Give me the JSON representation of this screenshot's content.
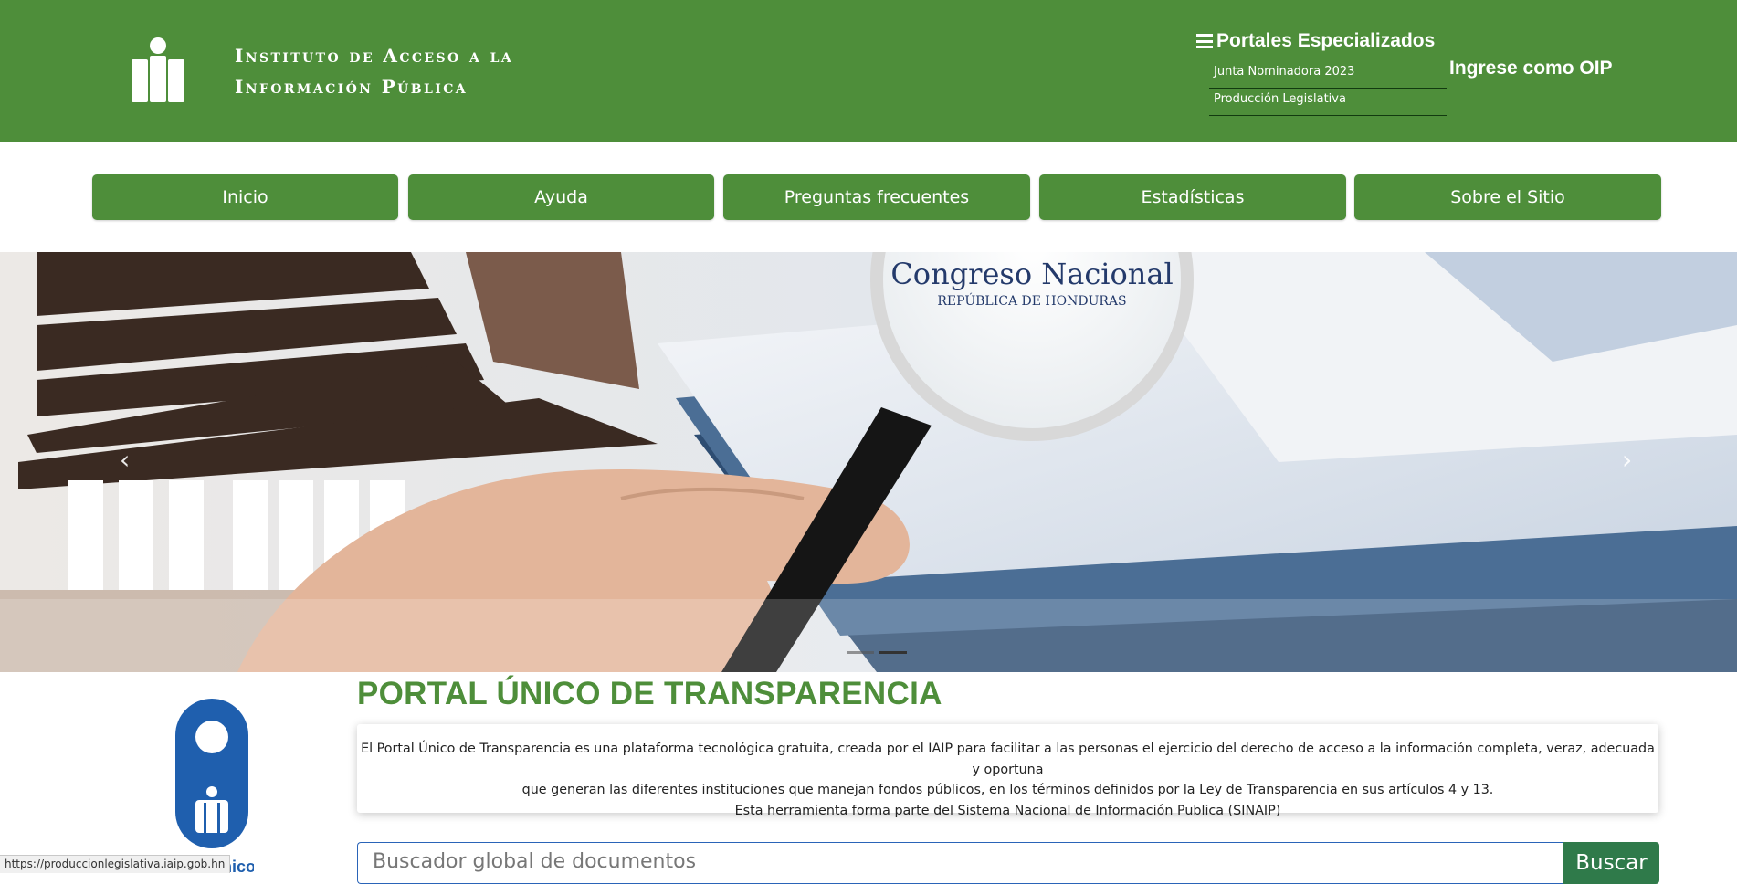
{
  "header": {
    "institute_line1": "Instituto de Acceso a la",
    "institute_line2": "Información Pública",
    "portales_title": "Portales Especializados",
    "portal_links": [
      "Junta Nominadora 2023",
      "Producción Legislativa"
    ],
    "login": "Ingrese como OIP"
  },
  "nav": {
    "items": [
      "Inicio",
      "Ayuda",
      "Preguntas frecuentes",
      "Estadísticas",
      "Sobre el Sitio"
    ]
  },
  "carousel": {
    "banner_title": "Congreso Nacional",
    "banner_subtitle": "REPÚBLICA DE HONDURAS",
    "prev_icon": "‹",
    "next_icon": "›",
    "slide_count": 2,
    "active_slide": 2
  },
  "main": {
    "title": "PORTAL ÚNICO DE TRANSPARENCIA",
    "description_line1": "El Portal Único de Transparencia es una plataforma tecnológica gratuita, creada por el IAIP para facilitar a las personas el ejercicio del derecho de acceso a la información completa, veraz, adecuada y oportuna",
    "description_line2": "que generan las diferentes instituciones que manejan fondos públicos, en los términos definidos por la Ley de Transparencia en sus artículos 4 y 13.",
    "description_line3": "Esta herramienta forma parte del Sistema Nacional de Información Publica (SINAIP)",
    "logo_caption": "al Único",
    "search_placeholder": "Buscador global de documentos",
    "search_button": "Buscar"
  },
  "status_bar": {
    "url": "https://produccionlegislativa.iaip.gob.hn"
  },
  "colors": {
    "brand_green": "#4e8e3a",
    "search_button": "#2f7a4a",
    "logo_blue": "#1f5fae"
  }
}
